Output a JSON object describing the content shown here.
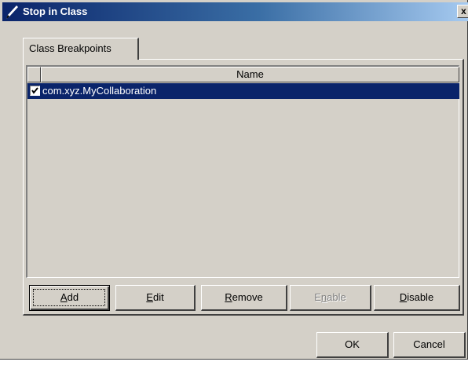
{
  "window": {
    "title": "Stop in Class",
    "close_glyph": "x",
    "icon": "pencil-icon"
  },
  "tabs": [
    {
      "label": "Class Breakpoints",
      "selected": true
    }
  ],
  "table": {
    "columns": [
      "",
      "Name"
    ],
    "rows": [
      {
        "checked": true,
        "name": "com.xyz.MyCollaboration",
        "selected": true
      }
    ]
  },
  "buttons": {
    "add": {
      "label": "Add",
      "mnemonic": "A",
      "rest": "dd"
    },
    "edit": {
      "label": "Edit",
      "mnemonic": "E",
      "rest": "dit"
    },
    "remove": {
      "label": "Remove",
      "mnemonic": "R",
      "rest": "emove"
    },
    "enable": {
      "label": "Enable",
      "pre": "E",
      "mnemonic": "n",
      "rest": "able",
      "disabled": true
    },
    "disable": {
      "label": "Disable",
      "mnemonic": "D",
      "rest": "isable"
    },
    "ok": {
      "label": "OK"
    },
    "cancel": {
      "label": "Cancel"
    }
  },
  "colors": {
    "face": "#d4d0c8",
    "selection": "#0a246a",
    "title_start": "#0a246a",
    "title_end": "#a6caf0"
  }
}
